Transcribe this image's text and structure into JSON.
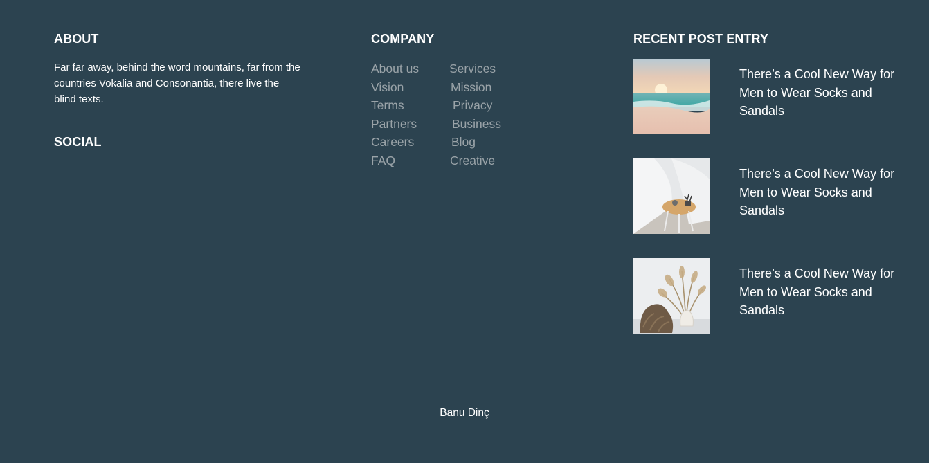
{
  "about": {
    "heading": "ABOUT",
    "text": "Far far away, behind the word mountains, far from the countries Vokalia and Consonantia, there live the blind texts.",
    "social_heading": "SOCIAL"
  },
  "company": {
    "heading": "COMPANY",
    "links": [
      "About us",
      "Services",
      "Vision",
      "Mission",
      "Terms",
      "Privacy",
      "Partners",
      "Business",
      "Careers",
      "Blog",
      "FAQ",
      "Creative"
    ]
  },
  "recent_posts": {
    "heading": "RECENT POST ENTRY",
    "posts": [
      {
        "title": "There’s a Cool New Way for Men to Wear Socks and Sandals",
        "image": "beach-sunset-image"
      },
      {
        "title": "There’s a Cool New Way for Men to Wear Socks and Sandals",
        "image": "side-table-interior-image"
      },
      {
        "title": "There’s a Cool New Way for Men to Wear Socks and Sandals",
        "image": "dried-grass-vase-image"
      }
    ]
  },
  "footer": {
    "credit": "Banu Dinç"
  },
  "colors": {
    "background": "#2c4350",
    "heading_text": "#ffffff",
    "link_text": "#9aa3a8"
  }
}
